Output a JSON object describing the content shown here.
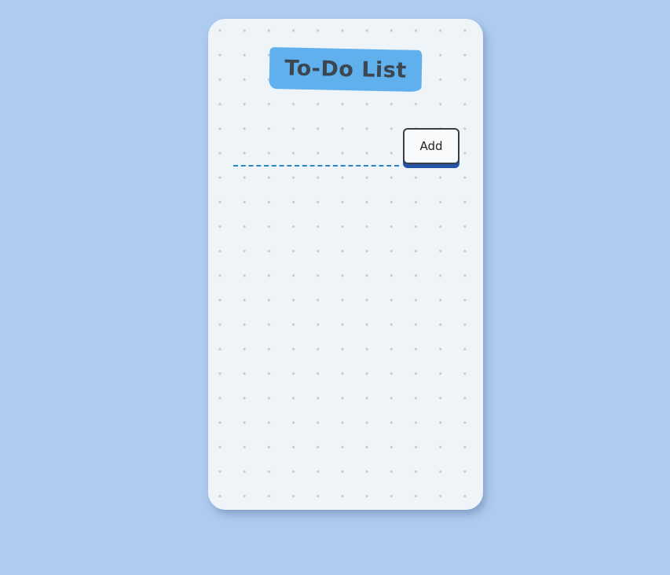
{
  "app": {
    "title": "To-Do List"
  },
  "form": {
    "input_value": "",
    "input_placeholder": "",
    "add_label": "Add"
  },
  "tasks": [],
  "colors": {
    "background": "#aecbf0",
    "card": "#eff4f8",
    "title_tape": "#5fb0ec",
    "input_underline": "#2a87c2",
    "button_shadow": "#2453a8"
  }
}
